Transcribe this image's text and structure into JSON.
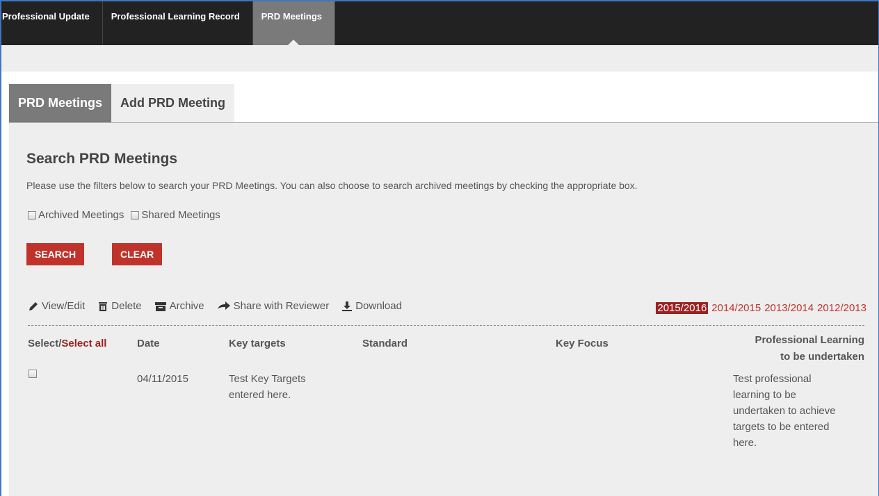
{
  "topnav": {
    "tabs": [
      {
        "label": "Professional Update"
      },
      {
        "label": "Professional Learning Record"
      },
      {
        "label": "PRD Meetings"
      }
    ]
  },
  "subtabs": [
    {
      "label": "PRD Meetings"
    },
    {
      "label": "Add PRD Meeting"
    }
  ],
  "search": {
    "title": "Search PRD Meetings",
    "description": "Please use the filters below to search your PRD Meetings. You can also choose to search archived meetings by checking the appropriate box.",
    "archived_label": "Archived Meetings",
    "shared_label": "Shared Meetings",
    "search_button": "SEARCH",
    "clear_button": "CLEAR"
  },
  "toolbar": {
    "view_edit": "View/Edit",
    "delete": "Delete",
    "archive": "Archive",
    "share": "Share with Reviewer",
    "download": "Download"
  },
  "years": [
    "2015/2016",
    "2014/2015",
    "2013/2014",
    "2012/2013"
  ],
  "table": {
    "select_label": "Select/",
    "select_all": "Select all",
    "headers": {
      "date": "Date",
      "key_targets": "Key targets",
      "standard": "Standard",
      "key_focus": "Key Focus",
      "pl_line1": "Professional Learning",
      "pl_line2": "to be undertaken"
    },
    "rows": [
      {
        "date": "04/11/2015",
        "key_targets_1": "Test Key Targets",
        "key_targets_2": "entered here.",
        "pl_1": "Test professional",
        "pl_2": "learning to be",
        "pl_3": "undertaken to achieve",
        "pl_4": "targets to be entered",
        "pl_5": "here."
      }
    ]
  },
  "colors": {
    "accent_red": "#c0332b",
    "nav_dark": "#222222",
    "active_tab": "#7a7a7a"
  }
}
